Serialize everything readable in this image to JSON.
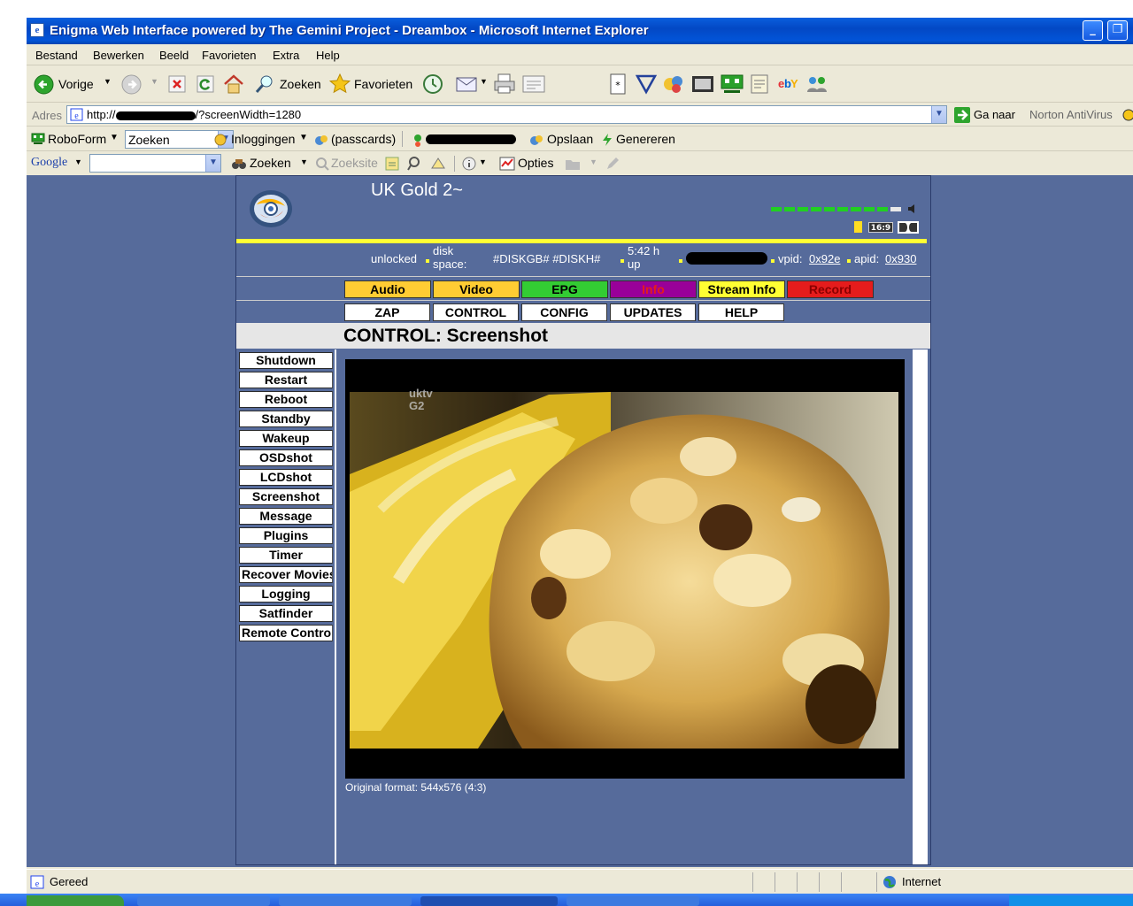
{
  "window": {
    "title": "Enigma Web Interface powered by The Gemini Project - Dreambox - Microsoft Internet Explorer"
  },
  "menu": [
    "Bestand",
    "Bewerken",
    "Beeld",
    "Favorieten",
    "Extra",
    "Help"
  ],
  "toolbar": {
    "back_label": "Vorige",
    "search_label": "Zoeken",
    "favorites_label": "Favorieten"
  },
  "address": {
    "label": "Adres",
    "url_prefix": "http://",
    "url_suffix": "/?screenWidth=1280",
    "go_label": "Ga naar",
    "norton_label": "Norton AntiVirus"
  },
  "roboform": {
    "brand": "RoboForm",
    "search_value": "Zoeken",
    "logins_label": "Inloggingen",
    "passcards_label": "(passcards)",
    "save_label": "Opslaan",
    "generate_label": "Genereren"
  },
  "google": {
    "brand": "Google",
    "search_label": "Zoeken",
    "site_label": "Zoeksite",
    "options_label": "Opties"
  },
  "enigma": {
    "channel": "UK Gold 2~",
    "aspect": "16:9",
    "status": {
      "lock": "unlocked",
      "disk_label": "disk space:",
      "disk_value": "#DISKGB# #DISKH#",
      "uptime": "5:42 h up",
      "vpid_label": "vpid:",
      "vpid_value": "0x92e",
      "apid_label": "apid:",
      "apid_value": "0x930"
    },
    "tabs": [
      {
        "label": "Audio",
        "color": "#ffcc33"
      },
      {
        "label": "Video",
        "color": "#ffcc33"
      },
      {
        "label": "EPG",
        "color": "#33cc33"
      },
      {
        "label": "Info",
        "color": "#990099"
      },
      {
        "label": "Stream Info",
        "color": "#ffff33"
      },
      {
        "label": "Record",
        "color": "#e51c1c"
      }
    ],
    "nav": [
      "ZAP",
      "CONTROL",
      "CONFIG",
      "UPDATES",
      "HELP"
    ],
    "page_title": "CONTROL: Screenshot",
    "side_buttons": [
      "Shutdown",
      "Restart",
      "Reboot",
      "Standby",
      "Wakeup",
      "OSDshot",
      "LCDshot",
      "Screenshot",
      "Message",
      "Plugins",
      "Timer",
      "Recover Movies",
      "Logging",
      "Satfinder",
      "Remote Control"
    ],
    "screenshot": {
      "watermark": "uktv G2",
      "caption": "Original format: 544x576 (4:3)"
    }
  },
  "statusbar": {
    "state": "Gereed",
    "zone": "Internet"
  }
}
